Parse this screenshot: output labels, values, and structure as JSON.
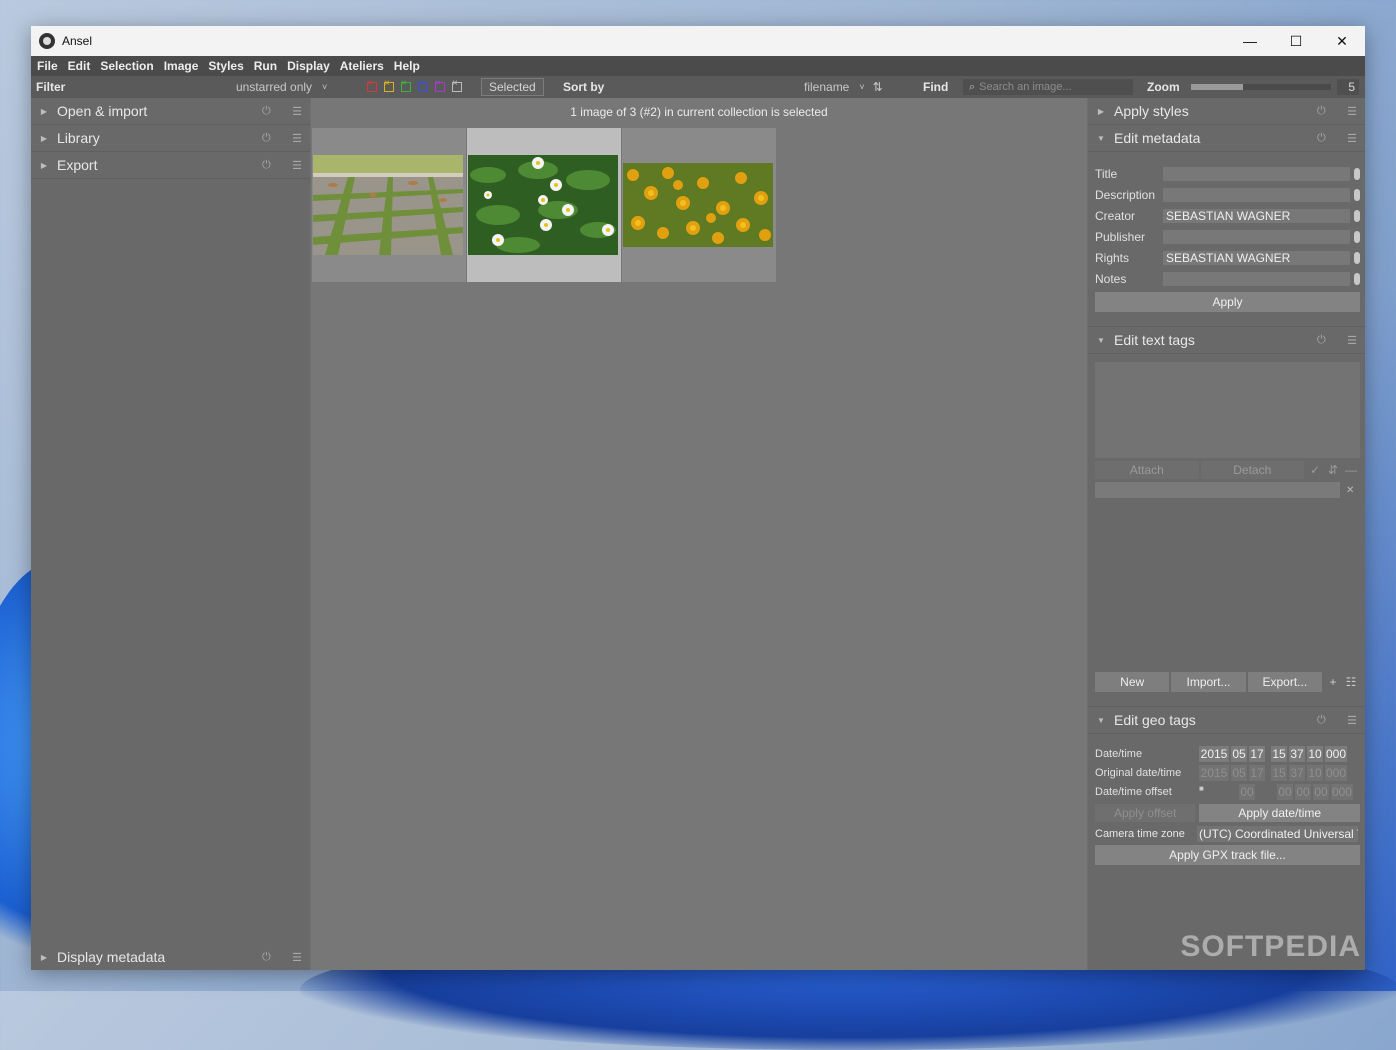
{
  "window": {
    "title": "Ansel"
  },
  "menu": [
    "File",
    "Edit",
    "Selection",
    "Image",
    "Styles",
    "Run",
    "Display",
    "Ateliers",
    "Help"
  ],
  "toolbar": {
    "filter_label": "Filter",
    "filter_value": "unstarred only",
    "selected_label": "Selected",
    "sort_label": "Sort by",
    "sort_value": "filename",
    "find_label": "Find",
    "search_placeholder": "Search an image...",
    "zoom_label": "Zoom",
    "zoom_value": "5",
    "color_labels": [
      "#d33a3a",
      "#d9b21e",
      "#3cb43c",
      "#3a4fd9",
      "#a73ad0"
    ]
  },
  "left_modules": [
    "Open & import",
    "Library",
    "Export"
  ],
  "left_bottom_module": "Display metadata",
  "center": {
    "info": "1 image of 3 (#2) in current collection is selected",
    "thumbnails": [
      "stone-path-photo",
      "daisies-photo",
      "marigolds-photo"
    ],
    "selected_index": 1
  },
  "right": {
    "apply_styles": "Apply styles",
    "edit_metadata": "Edit metadata",
    "metadata": [
      {
        "label": "Title",
        "value": ""
      },
      {
        "label": "Description",
        "value": ""
      },
      {
        "label": "Creator",
        "value": "SEBASTIAN WAGNER"
      },
      {
        "label": "Publisher",
        "value": ""
      },
      {
        "label": "Rights",
        "value": "SEBASTIAN WAGNER"
      },
      {
        "label": "Notes",
        "value": ""
      }
    ],
    "apply_btn": "Apply",
    "edit_text_tags": "Edit text tags",
    "attach": "Attach",
    "detach": "Detach",
    "new_btn": "New",
    "import_btn": "Import...",
    "export_btn": "Export...",
    "edit_geo_tags": "Edit geo tags",
    "geo": {
      "datetime_label": "Date/time",
      "datetime": [
        "2015",
        "05",
        "17",
        "15",
        "37",
        "10",
        "000"
      ],
      "original_label": "Original date/time",
      "original": [
        "2015",
        "05",
        "17",
        "15",
        "37",
        "10",
        "000"
      ],
      "offset_label": "Date/time offset",
      "offset": [
        "00",
        "00",
        "00",
        "00",
        "000"
      ],
      "apply_offset": "Apply offset",
      "apply_datetime": "Apply date/time",
      "tz_label": "Camera time zone",
      "tz_value": "(UTC) Coordinated Universal Ti",
      "gpx_btn": "Apply GPX track file..."
    }
  },
  "watermark": "SOFTPEDIA"
}
